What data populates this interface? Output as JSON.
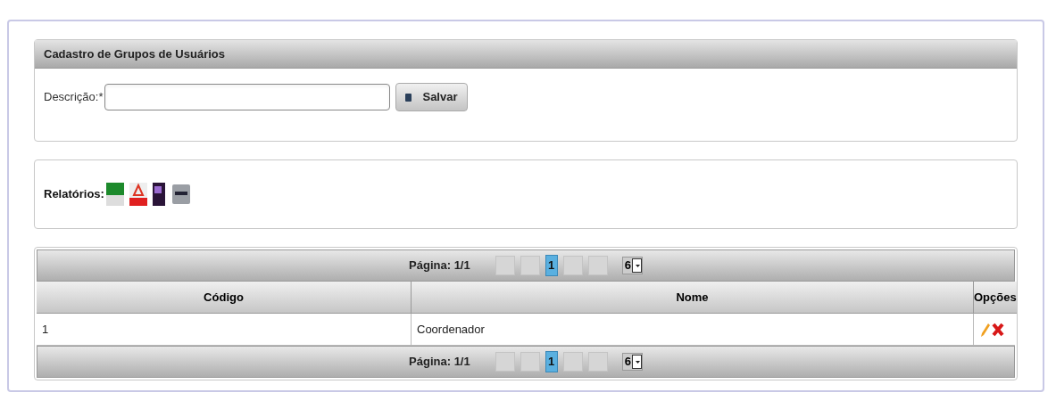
{
  "form": {
    "title": "Cadastro de Grupos de Usuários",
    "description_label": "Descrição:*",
    "save_button": "Salvar"
  },
  "reports": {
    "label": "Relatórios:"
  },
  "paginator_top": {
    "label": "Página: 1/1",
    "pages": [
      {
        "label": "1",
        "selected": true
      }
    ],
    "per_page": "6"
  },
  "table": {
    "columns": [
      "Código",
      "Nome",
      "Opções"
    ],
    "rows": [
      {
        "cells": [
          "1",
          "Coordenador"
        ]
      }
    ]
  },
  "paginator_bottom": {
    "label": "Página: 1/1",
    "pages": [
      {
        "label": "1",
        "selected": true
      }
    ],
    "per_page": "6"
  }
}
